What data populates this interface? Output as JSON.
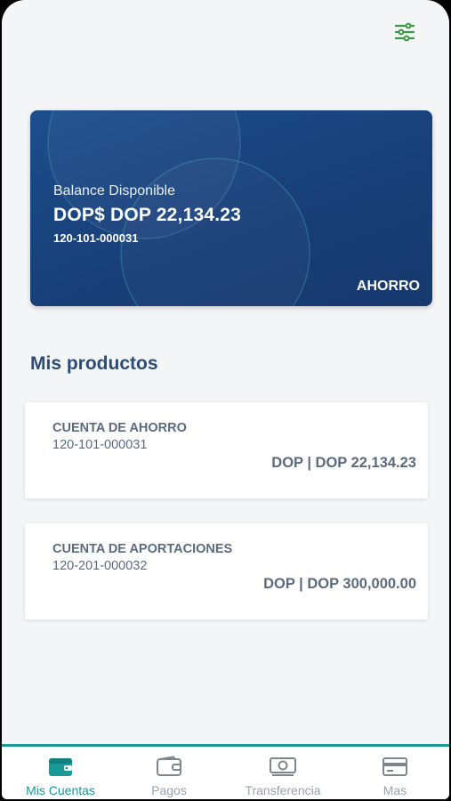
{
  "colors": {
    "accent": "#1a9a96",
    "card_blue": "#1d4e8c",
    "text_muted": "#5a6b80",
    "title": "#2b4c74"
  },
  "header": {
    "filter_icon": "sliders-icon"
  },
  "balance_card": {
    "label": "Balance Disponible",
    "amount": "DOP$ DOP 22,134.23",
    "account_number": "120-101-000031",
    "account_type": "AHORRO"
  },
  "products": {
    "title": "Mis productos",
    "items": [
      {
        "name": "CUENTA DE AHORRO",
        "number": "120-101-000031",
        "balance": "DOP | DOP 22,134.23"
      },
      {
        "name": "CUENTA DE APORTACIONES",
        "number": "120-201-000032",
        "balance": "DOP | DOP 300,000.00"
      }
    ]
  },
  "bottom_nav": {
    "items": [
      {
        "label": "Mis Cuentas",
        "icon": "wallet-icon",
        "active": true
      },
      {
        "label": "Pagos",
        "icon": "wallet-outline-icon",
        "active": false
      },
      {
        "label": "Transferencia",
        "icon": "money-icon",
        "active": false
      },
      {
        "label": "Mas",
        "icon": "card-icon",
        "active": false
      }
    ]
  }
}
